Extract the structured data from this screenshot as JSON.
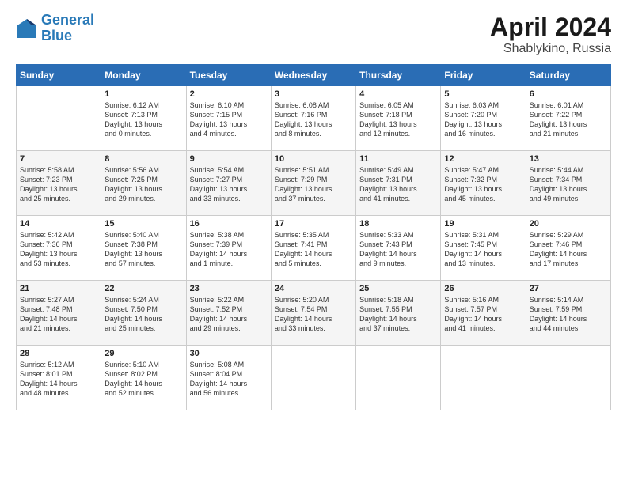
{
  "header": {
    "logo_line1": "General",
    "logo_line2": "Blue",
    "month": "April 2024",
    "location": "Shablykino, Russia"
  },
  "days_of_week": [
    "Sunday",
    "Monday",
    "Tuesday",
    "Wednesday",
    "Thursday",
    "Friday",
    "Saturday"
  ],
  "weeks": [
    [
      {
        "day": "",
        "info": ""
      },
      {
        "day": "1",
        "info": "Sunrise: 6:12 AM\nSunset: 7:13 PM\nDaylight: 13 hours\nand 0 minutes."
      },
      {
        "day": "2",
        "info": "Sunrise: 6:10 AM\nSunset: 7:15 PM\nDaylight: 13 hours\nand 4 minutes."
      },
      {
        "day": "3",
        "info": "Sunrise: 6:08 AM\nSunset: 7:16 PM\nDaylight: 13 hours\nand 8 minutes."
      },
      {
        "day": "4",
        "info": "Sunrise: 6:05 AM\nSunset: 7:18 PM\nDaylight: 13 hours\nand 12 minutes."
      },
      {
        "day": "5",
        "info": "Sunrise: 6:03 AM\nSunset: 7:20 PM\nDaylight: 13 hours\nand 16 minutes."
      },
      {
        "day": "6",
        "info": "Sunrise: 6:01 AM\nSunset: 7:22 PM\nDaylight: 13 hours\nand 21 minutes."
      }
    ],
    [
      {
        "day": "7",
        "info": "Sunrise: 5:58 AM\nSunset: 7:23 PM\nDaylight: 13 hours\nand 25 minutes."
      },
      {
        "day": "8",
        "info": "Sunrise: 5:56 AM\nSunset: 7:25 PM\nDaylight: 13 hours\nand 29 minutes."
      },
      {
        "day": "9",
        "info": "Sunrise: 5:54 AM\nSunset: 7:27 PM\nDaylight: 13 hours\nand 33 minutes."
      },
      {
        "day": "10",
        "info": "Sunrise: 5:51 AM\nSunset: 7:29 PM\nDaylight: 13 hours\nand 37 minutes."
      },
      {
        "day": "11",
        "info": "Sunrise: 5:49 AM\nSunset: 7:31 PM\nDaylight: 13 hours\nand 41 minutes."
      },
      {
        "day": "12",
        "info": "Sunrise: 5:47 AM\nSunset: 7:32 PM\nDaylight: 13 hours\nand 45 minutes."
      },
      {
        "day": "13",
        "info": "Sunrise: 5:44 AM\nSunset: 7:34 PM\nDaylight: 13 hours\nand 49 minutes."
      }
    ],
    [
      {
        "day": "14",
        "info": "Sunrise: 5:42 AM\nSunset: 7:36 PM\nDaylight: 13 hours\nand 53 minutes."
      },
      {
        "day": "15",
        "info": "Sunrise: 5:40 AM\nSunset: 7:38 PM\nDaylight: 13 hours\nand 57 minutes."
      },
      {
        "day": "16",
        "info": "Sunrise: 5:38 AM\nSunset: 7:39 PM\nDaylight: 14 hours\nand 1 minute."
      },
      {
        "day": "17",
        "info": "Sunrise: 5:35 AM\nSunset: 7:41 PM\nDaylight: 14 hours\nand 5 minutes."
      },
      {
        "day": "18",
        "info": "Sunrise: 5:33 AM\nSunset: 7:43 PM\nDaylight: 14 hours\nand 9 minutes."
      },
      {
        "day": "19",
        "info": "Sunrise: 5:31 AM\nSunset: 7:45 PM\nDaylight: 14 hours\nand 13 minutes."
      },
      {
        "day": "20",
        "info": "Sunrise: 5:29 AM\nSunset: 7:46 PM\nDaylight: 14 hours\nand 17 minutes."
      }
    ],
    [
      {
        "day": "21",
        "info": "Sunrise: 5:27 AM\nSunset: 7:48 PM\nDaylight: 14 hours\nand 21 minutes."
      },
      {
        "day": "22",
        "info": "Sunrise: 5:24 AM\nSunset: 7:50 PM\nDaylight: 14 hours\nand 25 minutes."
      },
      {
        "day": "23",
        "info": "Sunrise: 5:22 AM\nSunset: 7:52 PM\nDaylight: 14 hours\nand 29 minutes."
      },
      {
        "day": "24",
        "info": "Sunrise: 5:20 AM\nSunset: 7:54 PM\nDaylight: 14 hours\nand 33 minutes."
      },
      {
        "day": "25",
        "info": "Sunrise: 5:18 AM\nSunset: 7:55 PM\nDaylight: 14 hours\nand 37 minutes."
      },
      {
        "day": "26",
        "info": "Sunrise: 5:16 AM\nSunset: 7:57 PM\nDaylight: 14 hours\nand 41 minutes."
      },
      {
        "day": "27",
        "info": "Sunrise: 5:14 AM\nSunset: 7:59 PM\nDaylight: 14 hours\nand 44 minutes."
      }
    ],
    [
      {
        "day": "28",
        "info": "Sunrise: 5:12 AM\nSunset: 8:01 PM\nDaylight: 14 hours\nand 48 minutes."
      },
      {
        "day": "29",
        "info": "Sunrise: 5:10 AM\nSunset: 8:02 PM\nDaylight: 14 hours\nand 52 minutes."
      },
      {
        "day": "30",
        "info": "Sunrise: 5:08 AM\nSunset: 8:04 PM\nDaylight: 14 hours\nand 56 minutes."
      },
      {
        "day": "",
        "info": ""
      },
      {
        "day": "",
        "info": ""
      },
      {
        "day": "",
        "info": ""
      },
      {
        "day": "",
        "info": ""
      }
    ]
  ]
}
